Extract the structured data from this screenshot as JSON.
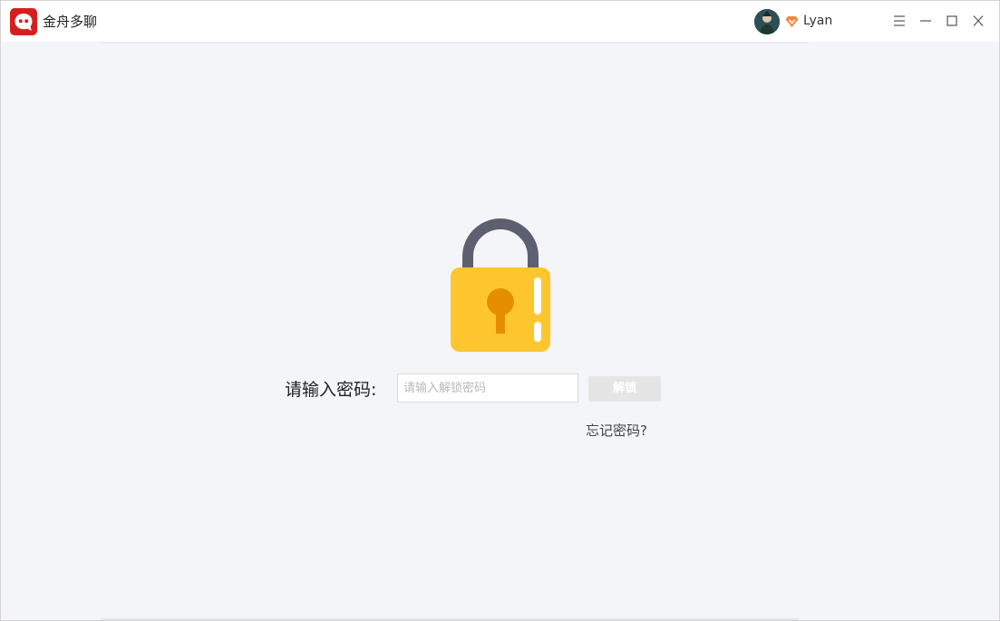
{
  "app": {
    "title": "金舟多聊",
    "logo_icon": "app-logo-icon",
    "brand_color": "#d3201f"
  },
  "user": {
    "name": "Lyan",
    "avatar_icon": "avatar-icon",
    "badge_icon": "vip-diamond-icon"
  },
  "window_controls": {
    "menu_icon": "menu-icon",
    "minimize_icon": "minimize-icon",
    "maximize_icon": "maximize-icon",
    "close_icon": "close-icon"
  },
  "lock_screen": {
    "lock_icon": "padlock-icon",
    "lock_colors": {
      "body": "#fec62e",
      "shackle": "#5c6070",
      "keyhole": "#e58f00"
    },
    "prompt_label": "请输入密码:",
    "password_placeholder": "请输入解锁密码",
    "password_value": "",
    "unlock_label": "解锁",
    "forgot_label": "忘记密码?"
  }
}
